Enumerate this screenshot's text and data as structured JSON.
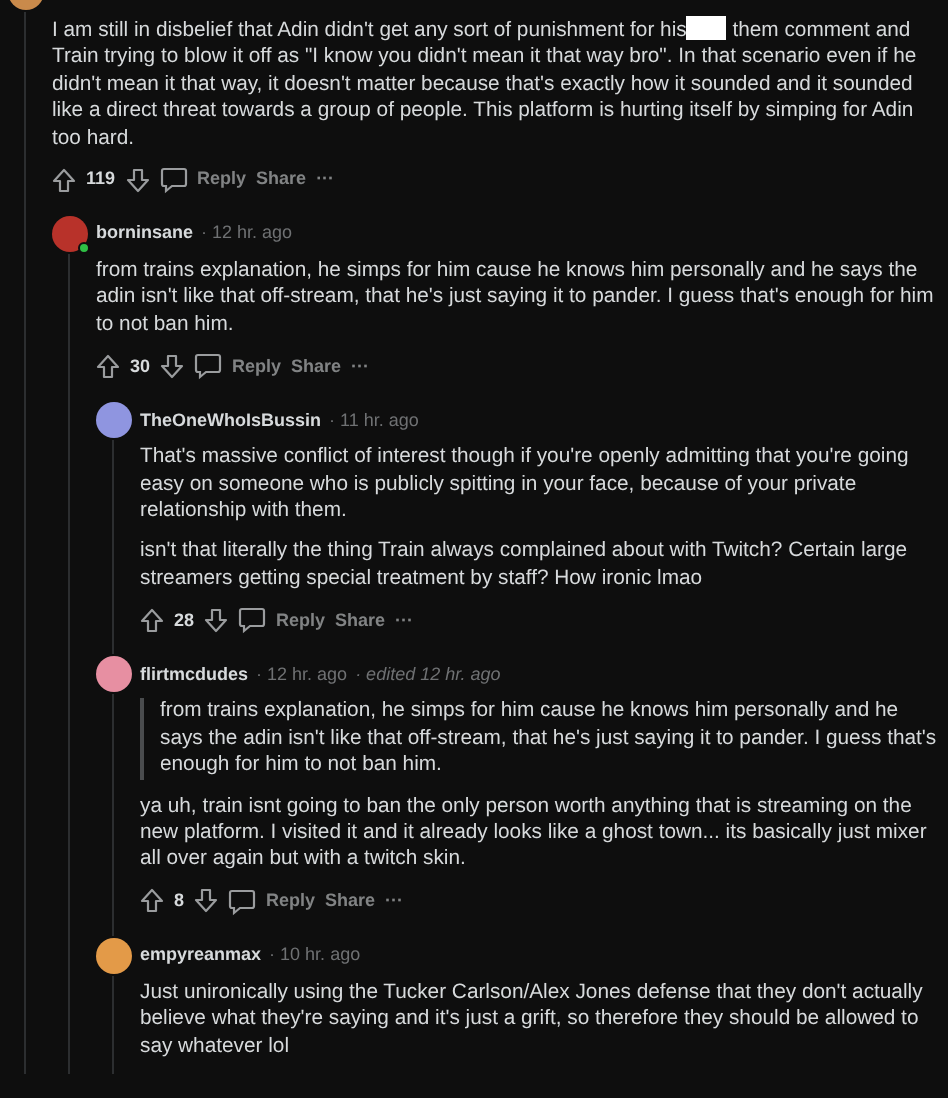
{
  "comments": [
    {
      "color": "#c98a4b",
      "online": false,
      "paragraphs": [
        {
          "kind": "redacted",
          "before": "I am still in disbelief that Adin didn't get any sort of punishment for his",
          "after": "them comment and Train trying to blow it off as \"I know you didn't mean it that way bro\". In that scenario even if he didn't mean it that way, it doesn't matter because that's exactly how it sounded and it sounded like a direct threat towards a group of people. This platform is hurting itself by simping for Adin too hard."
        }
      ],
      "score": "119",
      "actions": [
        "Reply",
        "Share",
        "···"
      ],
      "children": [
        {
          "author": "borninsane",
          "time": "· 12 hr. ago",
          "color": "#b8322a",
          "online": true,
          "paragraphs": [
            {
              "kind": "text",
              "text": "from trains explanation, he simps for him cause he knows him personally and he says the adin isn't like that off-stream, that he's just saying it to pander. I guess that's enough for him to not ban him."
            }
          ],
          "score": "30",
          "actions": [
            "Reply",
            "Share",
            "···"
          ],
          "children": [
            {
              "author": "TheOneWhoIsBussin",
              "time": "· 11 hr. ago",
              "color": "#8f95e0",
              "online": false,
              "paragraphs": [
                {
                  "kind": "text",
                  "text": "That's massive conflict of interest though if you're openly admitting that you're going easy on someone who is publicly spitting in your face, because of your private relationship with them."
                },
                {
                  "kind": "text",
                  "text": "isn't that literally the thing Train always complained about with Twitch? Certain large streamers getting special treatment by staff? How ironic lmao"
                }
              ],
              "score": "28",
              "actions": [
                "Reply",
                "Share",
                "···"
              ]
            },
            {
              "author": "flirtmcdudes",
              "time": "· 12 hr. ago",
              "edited": "· edited 12 hr. ago",
              "color": "#e78fa2",
              "online": false,
              "paragraphs": [
                {
                  "kind": "quote",
                  "text": "from trains explanation, he simps for him cause he knows him personally and he says the adin isn't like that off-stream, that he's just saying it to pander. I guess that's enough for him to not ban him."
                },
                {
                  "kind": "text",
                  "text": "ya uh, train isnt going to ban the only person worth anything that is streaming on the new platform. I visited it and it already looks like a ghost town... its basically just mixer all over again but with a twitch skin."
                }
              ],
              "score": "8",
              "actions": [
                "Reply",
                "Share",
                "···"
              ]
            },
            {
              "author": "empyreanmax",
              "time": "· 10 hr. ago",
              "color": "#e39a48",
              "online": false,
              "paragraphs": [
                {
                  "kind": "text",
                  "text": "Just unironically using the Tucker Carlson/Alex Jones defense that they don't actually believe what they're saying and it's just a grift, so therefore they should be allowed to say whatever lol"
                }
              ]
            }
          ]
        }
      ]
    }
  ]
}
